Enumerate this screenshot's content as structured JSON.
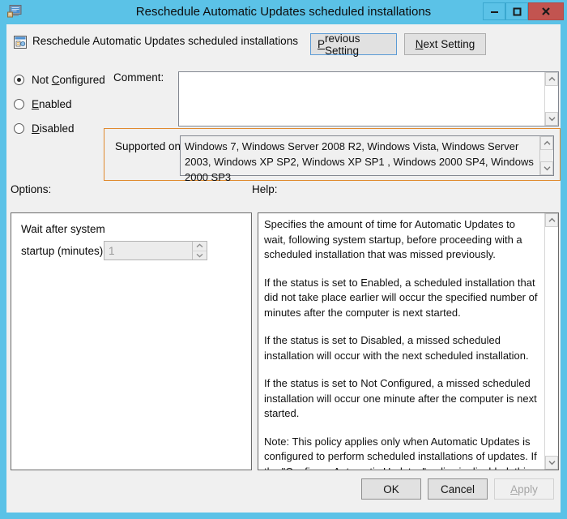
{
  "window": {
    "title": "Reschedule Automatic Updates scheduled installations",
    "icon": "computer-monitor-icon",
    "caption_buttons": {
      "minimize": "–",
      "maximize": "□",
      "close": "X"
    },
    "colors": {
      "titlebar": "#5bc2e7",
      "close_button": "#c25450",
      "focus_outline": "#e08a2e",
      "client_background": "#f0f0f0"
    }
  },
  "header": {
    "icon": "policy-setting-icon",
    "policy_title": "Reschedule Automatic Updates scheduled installations",
    "previous_button": {
      "prefix": "",
      "accel": "P",
      "suffix": "revious Setting"
    },
    "next_button": {
      "prefix": "",
      "accel": "N",
      "suffix": "ext Setting"
    }
  },
  "state_options": {
    "selected": "Not Configured",
    "items": [
      {
        "prefix": "Not ",
        "accel": "C",
        "suffix": "onfigured",
        "selected": true
      },
      {
        "prefix": "",
        "accel": "E",
        "suffix": "nabled",
        "selected": false
      },
      {
        "prefix": "",
        "accel": "D",
        "suffix": "isabled",
        "selected": false
      }
    ]
  },
  "comment": {
    "label": "Comment:",
    "value": "",
    "placeholder": ""
  },
  "supported_on": {
    "label": "Supported on:",
    "value": "Windows 7, Windows Server 2008 R2, Windows Vista, Windows Server 2003, Windows XP SP2, Windows XP SP1 , Windows 2000 SP4, Windows 2000 SP3"
  },
  "options": {
    "label": "Options:",
    "field_label_line1": "Wait after system",
    "field_label_line2": "startup (minutes):",
    "spinner_value": "1",
    "spinner_up_glyph": "∧",
    "spinner_down_glyph": "∨"
  },
  "help": {
    "label": "Help:",
    "paragraphs": [
      "Specifies the amount of time for Automatic Updates to wait, following system startup, before proceeding with a scheduled installation that was missed previously.",
      "If the status is set to Enabled, a scheduled installation that did not take place earlier will occur the specified number of minutes after the computer is next started.",
      "If the status is set to Disabled, a missed scheduled installation will occur with the next scheduled installation.",
      "If the status is set to Not Configured, a missed scheduled installation will occur one minute after the computer is next started.",
      "Note: This policy applies only when Automatic Updates is configured to perform scheduled installations of updates. If the \"Configure Automatic Updates\" policy is disabled, this policy has no effect."
    ]
  },
  "footer": {
    "ok_label": "OK",
    "cancel_label": "Cancel",
    "apply": {
      "prefix": "",
      "accel": "A",
      "suffix": "pply",
      "enabled": false
    }
  },
  "scrollbar": {
    "up_glyph": "∧",
    "down_glyph": "∨"
  }
}
